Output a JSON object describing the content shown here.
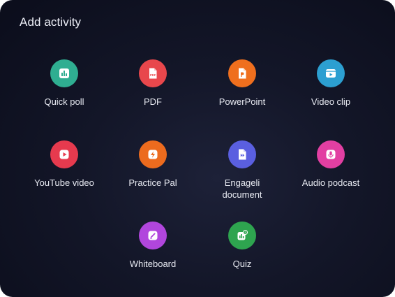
{
  "dialog": {
    "title": "Add activity"
  },
  "activities": [
    {
      "label": "Quick poll",
      "icon": "bar-chart-icon",
      "color": "#2fae91"
    },
    {
      "label": "PDF",
      "icon": "pdf-file-icon",
      "color": "#e8474c"
    },
    {
      "label": "PowerPoint",
      "icon": "powerpoint-file-icon",
      "color": "#ef6f1e"
    },
    {
      "label": "Video clip",
      "icon": "video-clip-icon",
      "color": "#2c9fd1"
    },
    {
      "label": "YouTube video",
      "icon": "youtube-play-icon",
      "color": "#e63a4e"
    },
    {
      "label": "Practice Pal",
      "icon": "lightning-bolt-icon",
      "color": "#ec6b1e"
    },
    {
      "label": "Engageli document",
      "icon": "document-icon",
      "color": "#5a5fe0"
    },
    {
      "label": "Audio podcast",
      "icon": "microphone-icon",
      "color": "#e23fa2"
    },
    {
      "label": "Whiteboard",
      "icon": "whiteboard-pen-icon",
      "color": "#b146dd"
    },
    {
      "label": "Quiz",
      "icon": "quiz-icon",
      "color": "#2ea44f"
    }
  ]
}
